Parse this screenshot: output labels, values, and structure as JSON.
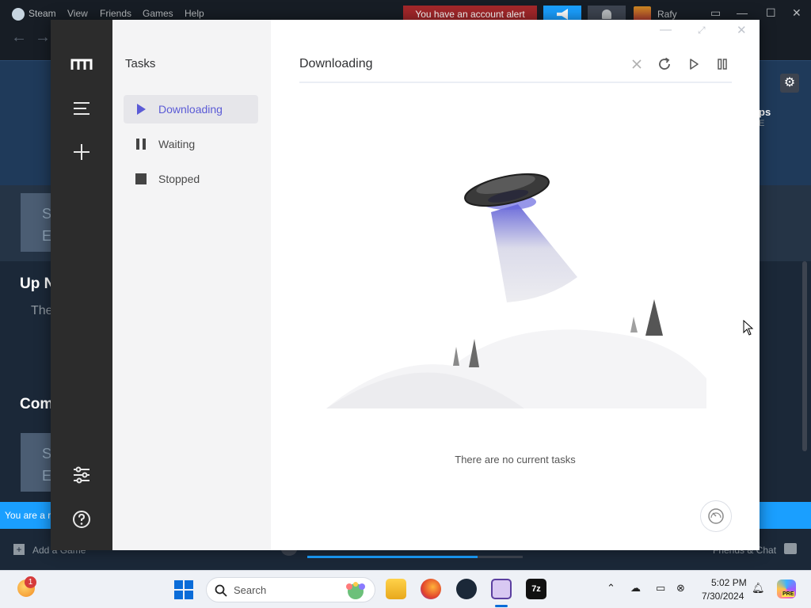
{
  "steam": {
    "menu": [
      "Steam",
      "View",
      "Friends",
      "Games",
      "Help"
    ],
    "alert": "You have an account alert",
    "username": "Rafy",
    "apps_label": "ps",
    "apps_sub": "E",
    "thumb_text_1": "S\nE",
    "thumb_text_2": "S\nE",
    "upnext_title": "Up N",
    "upnext_desc": "The",
    "community_title": "Com",
    "banner_text": "You are a r",
    "add_game": "Add a Game",
    "friends_chat": "Friends & Chat",
    "download_progress": 0.79
  },
  "motrix": {
    "subnav_title": "Tasks",
    "subnav_items": [
      {
        "label": "Downloading",
        "icon": "play-icon",
        "active": true
      },
      {
        "label": "Waiting",
        "icon": "pause-icon",
        "active": false
      },
      {
        "label": "Stopped",
        "icon": "stop-icon",
        "active": false
      }
    ],
    "main_title": "Downloading",
    "toolbar": [
      "close-icon",
      "refresh-icon",
      "resume-all-icon",
      "pause-all-icon"
    ],
    "empty_text": "There are no current tasks",
    "accent_color": "#5b5bd6"
  },
  "taskbar": {
    "weather_badge": "1",
    "search_label": "Search",
    "time": "5:02 PM",
    "date": "7/30/2024",
    "copilot_badge": "PRE"
  }
}
